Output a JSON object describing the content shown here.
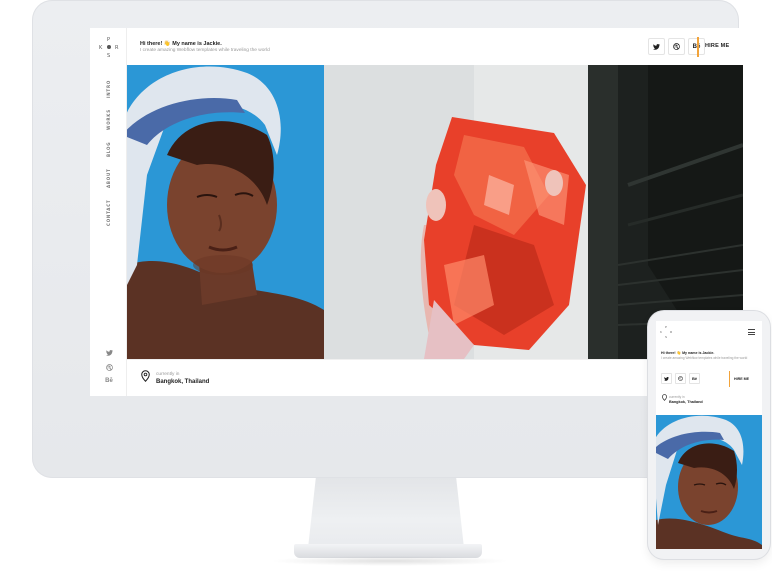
{
  "sidebar": {
    "logo_letters": {
      "top": "P",
      "left": "K",
      "right": "R",
      "bottom": "S"
    },
    "nav": [
      "INTRO",
      "WORKS",
      "BLOG",
      "ABOUT",
      "CONTACT"
    ],
    "social": [
      {
        "icon": "twitter-icon"
      },
      {
        "icon": "dribbble-icon"
      },
      {
        "icon": "behance-icon",
        "label": "Bē"
      }
    ]
  },
  "header": {
    "greeting": "Hi there!",
    "wave_emoji": "👋",
    "name_text": "My name is Jackie.",
    "tagline": "I create amazing Webflow templates while traveling the world",
    "social_buttons": [
      {
        "icon": "twitter-icon"
      },
      {
        "icon": "dribbble-icon"
      },
      {
        "icon": "behance-icon",
        "label": "Bē"
      }
    ],
    "hire_label": "HIRE ME"
  },
  "footer": {
    "location_label": "currently in",
    "location_value": "Bangkok, Thailand"
  },
  "colors": {
    "accent": "#f2a33a",
    "hero_blue": "#2d9ad8",
    "device_frame": "#e9ebee",
    "foil_red": "#e8402a"
  }
}
